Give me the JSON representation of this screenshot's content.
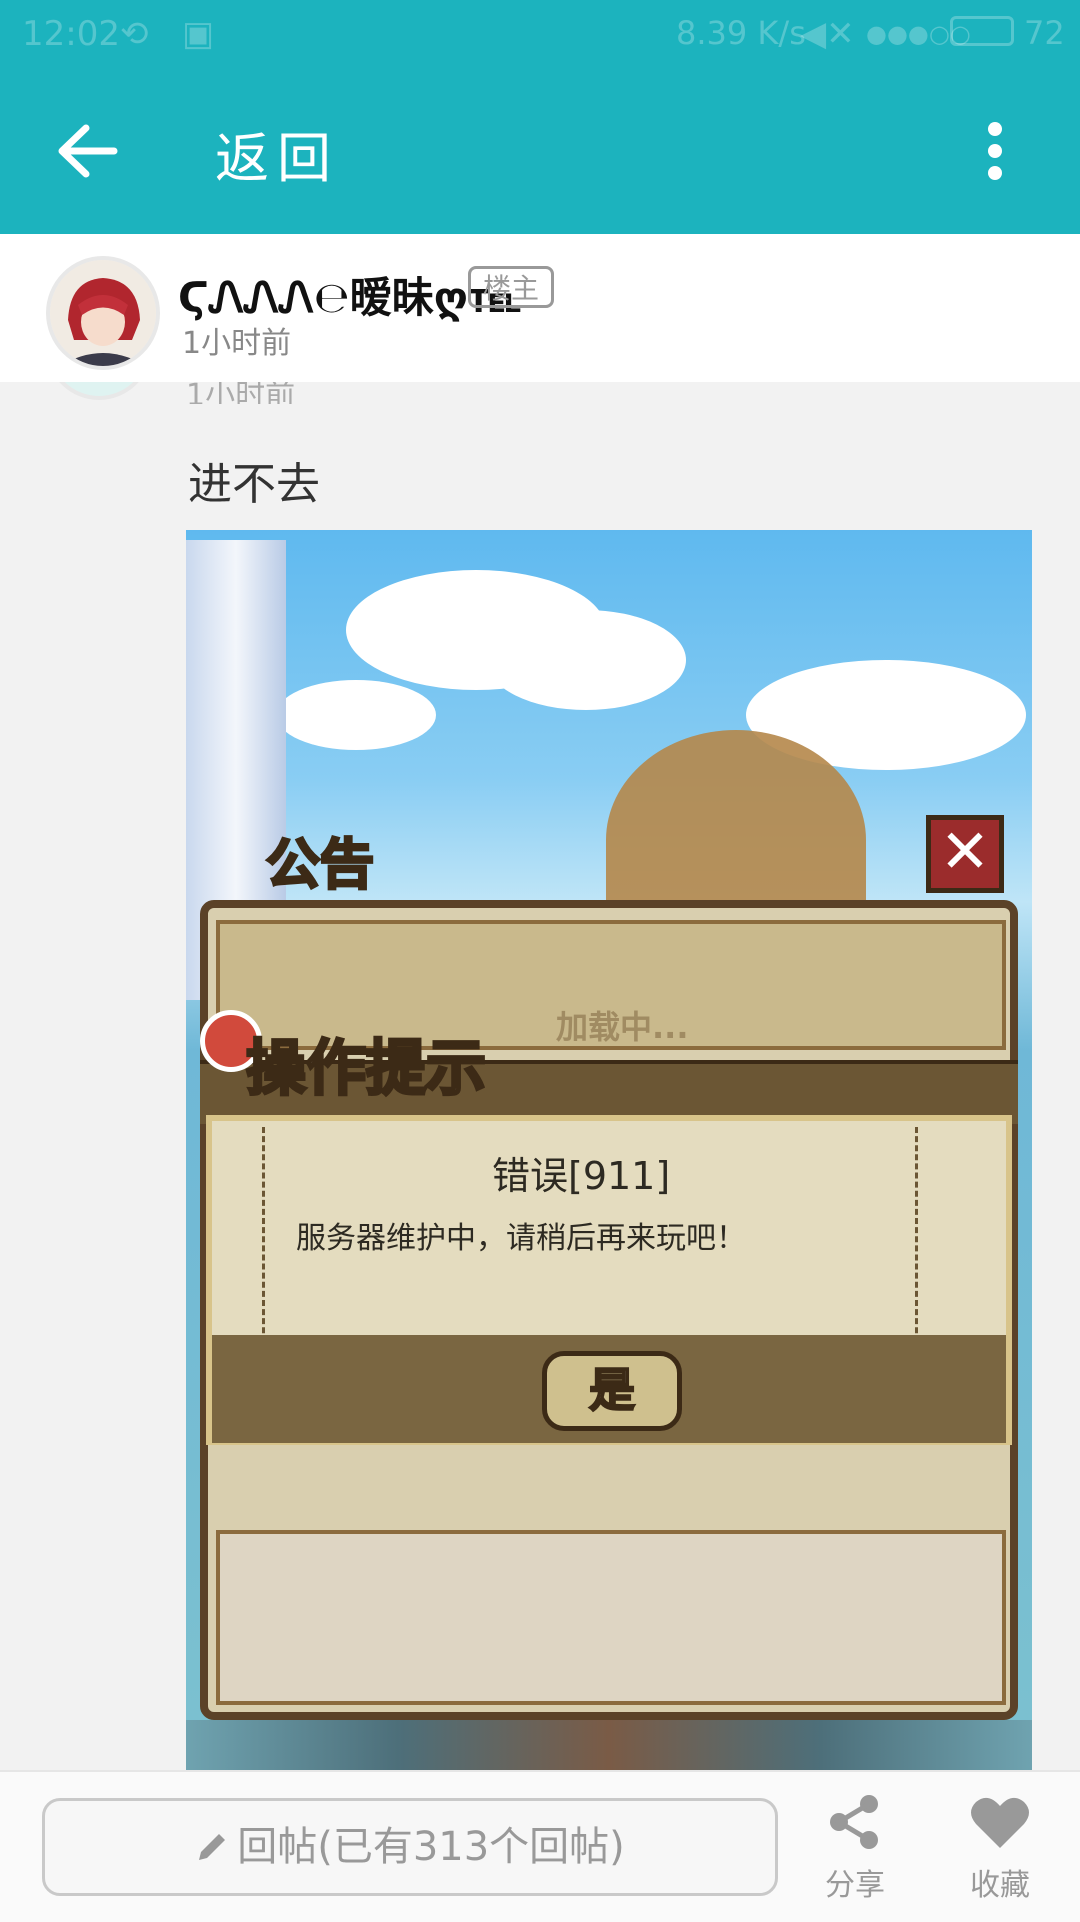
{
  "status_bar": {
    "time": "12:02",
    "net_speed": "8.39 K/s",
    "battery": "72"
  },
  "app_bar": {
    "title": "返回"
  },
  "post": {
    "author": "ϚᏁᏁᏁ℮暧昧ღ℡",
    "owner_badge": "楼主",
    "time": "1小时前",
    "text": "进不去"
  },
  "game_screen": {
    "notice_label": "公告",
    "loading_text": "加载中...",
    "tip_label": "操作提示",
    "error_title": "错误[911]",
    "error_message": "服务器维护中，请稍后再来玩吧！",
    "yes_button": "是"
  },
  "bottom_bar": {
    "reply_placeholder": "回帖(已有313个回帖)",
    "share_label": "分享",
    "favorite_label": "收藏"
  },
  "colors": {
    "accent": "#1cb3be"
  }
}
